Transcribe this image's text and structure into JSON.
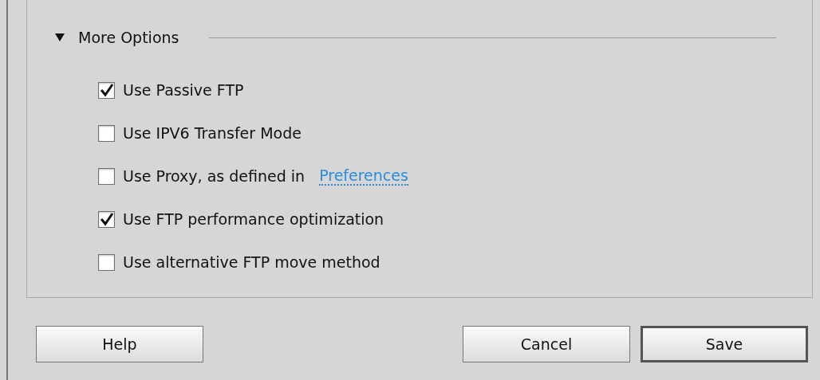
{
  "section": {
    "title": "More Options",
    "expanded": true
  },
  "options": [
    {
      "label": "Use Passive FTP",
      "checked": true
    },
    {
      "label": "Use IPV6 Transfer Mode",
      "checked": false
    },
    {
      "label": "Use Proxy, as defined in",
      "checked": false,
      "link": "Preferences"
    },
    {
      "label": "Use FTP performance optimization",
      "checked": true
    },
    {
      "label": "Use alternative FTP move method",
      "checked": false
    }
  ],
  "buttons": [
    {
      "label": "Help",
      "kind": "normal"
    },
    {
      "label": "Cancel",
      "kind": "normal"
    },
    {
      "label": "Save",
      "kind": "default"
    }
  ]
}
